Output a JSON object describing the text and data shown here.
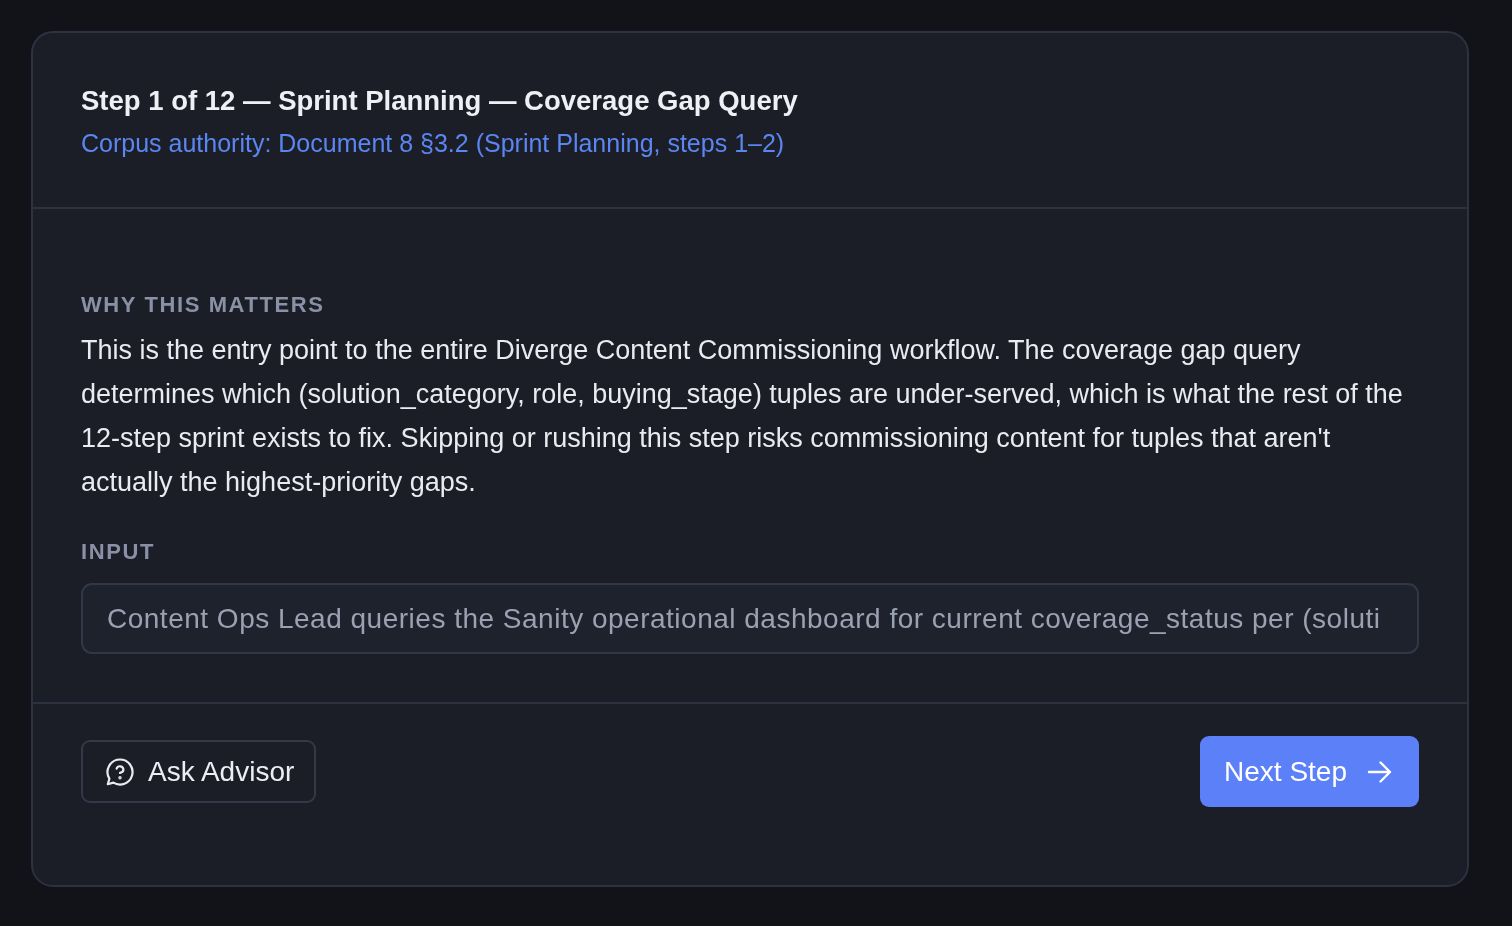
{
  "step_header": {
    "title": "Step 1 of 12 — Sprint Planning — Coverage Gap Query",
    "authority": "Corpus authority: Document 8 §3.2 (Sprint Planning, steps 1–2)"
  },
  "rationale": {
    "label": "WHY THIS MATTERS",
    "text": "This is the entry point to the entire Diverge Content Commissioning workflow. The coverage gap query determines which (solution_category, role, buying_stage) tuples are under-served, which is what the rest of the 12-step sprint exists to fix. Skipping or rushing this step risks commissioning content for tuples that aren't actually the highest-priority gaps."
  },
  "input": {
    "label": "INPUT",
    "value": "Content Ops Lead queries the Sanity operational dashboard for current coverage_status per (soluti"
  },
  "actions": [
    {
      "kind": "secondary",
      "label": "Ask Advisor"
    },
    {
      "kind": "primary",
      "label": "Next Step"
    }
  ]
}
